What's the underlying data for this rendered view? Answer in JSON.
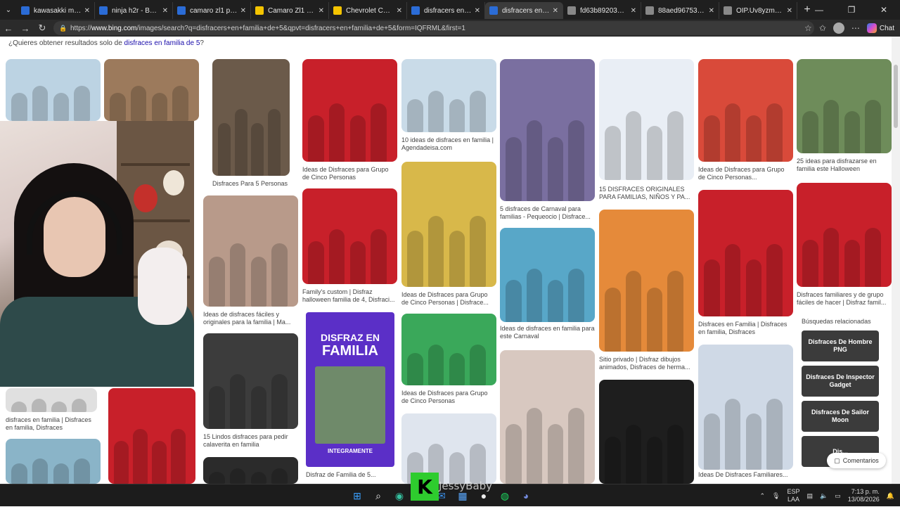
{
  "browser": {
    "tabs": [
      {
        "title": "kawasakki moto - Bi",
        "favicon_color": "#2b6cd6"
      },
      {
        "title": "ninja h2r - Búsqueda",
        "favicon_color": "#2b6cd6"
      },
      {
        "title": "camaro zl1 precio - B",
        "favicon_color": "#2b6cd6"
      },
      {
        "title": "Camaro Zl1 - Carros",
        "favicon_color": "#f4c400"
      },
      {
        "title": "Chevrolet Camaro Zl",
        "favicon_color": "#f4c400"
      },
      {
        "title": "disfracers en familia",
        "favicon_color": "#2b6cd6"
      },
      {
        "title": "disfracers en familia",
        "favicon_color": "#2b6cd6",
        "active": true
      },
      {
        "title": "fd63b892034f77b0f",
        "favicon_color": "#888888"
      },
      {
        "title": "88aed967539e0a7c3",
        "favicon_color": "#888888"
      },
      {
        "title": "OIP.Uv8yzmPH7k8E",
        "favicon_color": "#888888"
      }
    ],
    "url_prefix": "https://",
    "url_host": "www.bing.com",
    "url_path": "/images/search?q=disfracers+en+familia+de+5&qpvt=disfracers+en+familia+de+5&form=IQFRML&first=1",
    "chat_label": "Chat"
  },
  "page": {
    "suggest_prefix": "¿Quieres obtener resultados solo de ",
    "suggest_link": "disfraces en familia de 5",
    "suggest_suffix": "?"
  },
  "captions": [
    {
      "id": "c1",
      "text": "Disfraces Para 5 Personas"
    },
    {
      "id": "c2",
      "text": "Ideas de Disfraces para Grupo de Cinco Personas"
    },
    {
      "id": "c3",
      "text": "10 ideas de disfraces en familia | Agendadeisa.com"
    },
    {
      "id": "c4",
      "text": "5 disfraces de Carnaval para familias - Pequeocio | Disfrace..."
    },
    {
      "id": "c5",
      "text": "15 DISFRACES ORIGINALES PARA FAMILIAS, NIÑOS Y PA..."
    },
    {
      "id": "c6",
      "text": "Ideas de Disfraces para Grupo de Cinco Personas..."
    },
    {
      "id": "c7",
      "text": "25 ideas para disfrazarse en familia este Halloween"
    },
    {
      "id": "c8",
      "text": "Ideas de disfraces fáciles y originales para la familia | Ma..."
    },
    {
      "id": "c9",
      "text": "Family's custom | Disfraz halloween familia de 4, Disfraci..."
    },
    {
      "id": "c10",
      "text": "Ideas de Disfraces para Grupo de Cinco Personas | Disfrace..."
    },
    {
      "id": "c11",
      "text": "Ideas de disfraces en familia para este Carnaval"
    },
    {
      "id": "c12",
      "text": "Sitio privado | Disfraz dibujos animados, Disfraces de herma..."
    },
    {
      "id": "c13",
      "text": "Disfraces en Familia | Disfraces en familia, Disfraces"
    },
    {
      "id": "c14",
      "text": "Disfraces familiares y de grupo fáciles de hacer | Disfraz famil..."
    },
    {
      "id": "c15",
      "text": "Ideas de Disfraces para Grupo de Cinco Personas"
    },
    {
      "id": "c16",
      "text": "15 Lindos disfraces para pedir calaverita en familia"
    },
    {
      "id": "c17",
      "text": "disfraces en familia | Disfraces en familia, Disfraces"
    },
    {
      "id": "c18",
      "text": "Disfraz de Familia de 5..."
    },
    {
      "id": "c19",
      "text": "Ideas De Disfraces Familiares..."
    }
  ],
  "featured": {
    "line1": "DISFRAZ EN",
    "line2": "FAMILIA",
    "footer": "INTEGRAMENTE"
  },
  "related": {
    "title": "Búsquedas relacionadas",
    "items": [
      "Disfraces De Hombre PNG",
      "Disfraces De Inspector Gadget",
      "Disfraces De Sailor Moon",
      "Dis..."
    ]
  },
  "comentarios_label": "Comentarios",
  "overlay": {
    "kick_letter": "K",
    "streamer": "JessyBaby"
  },
  "tray": {
    "lang1": "ESP",
    "lang2": "LAA",
    "time": "7:13 p. m.",
    "date": "13/08/2026"
  },
  "colors": {
    "incredibles_red": "#c8202a",
    "purple_banner": "#5b2fc7",
    "tile_bg": "#d9d4cc"
  }
}
